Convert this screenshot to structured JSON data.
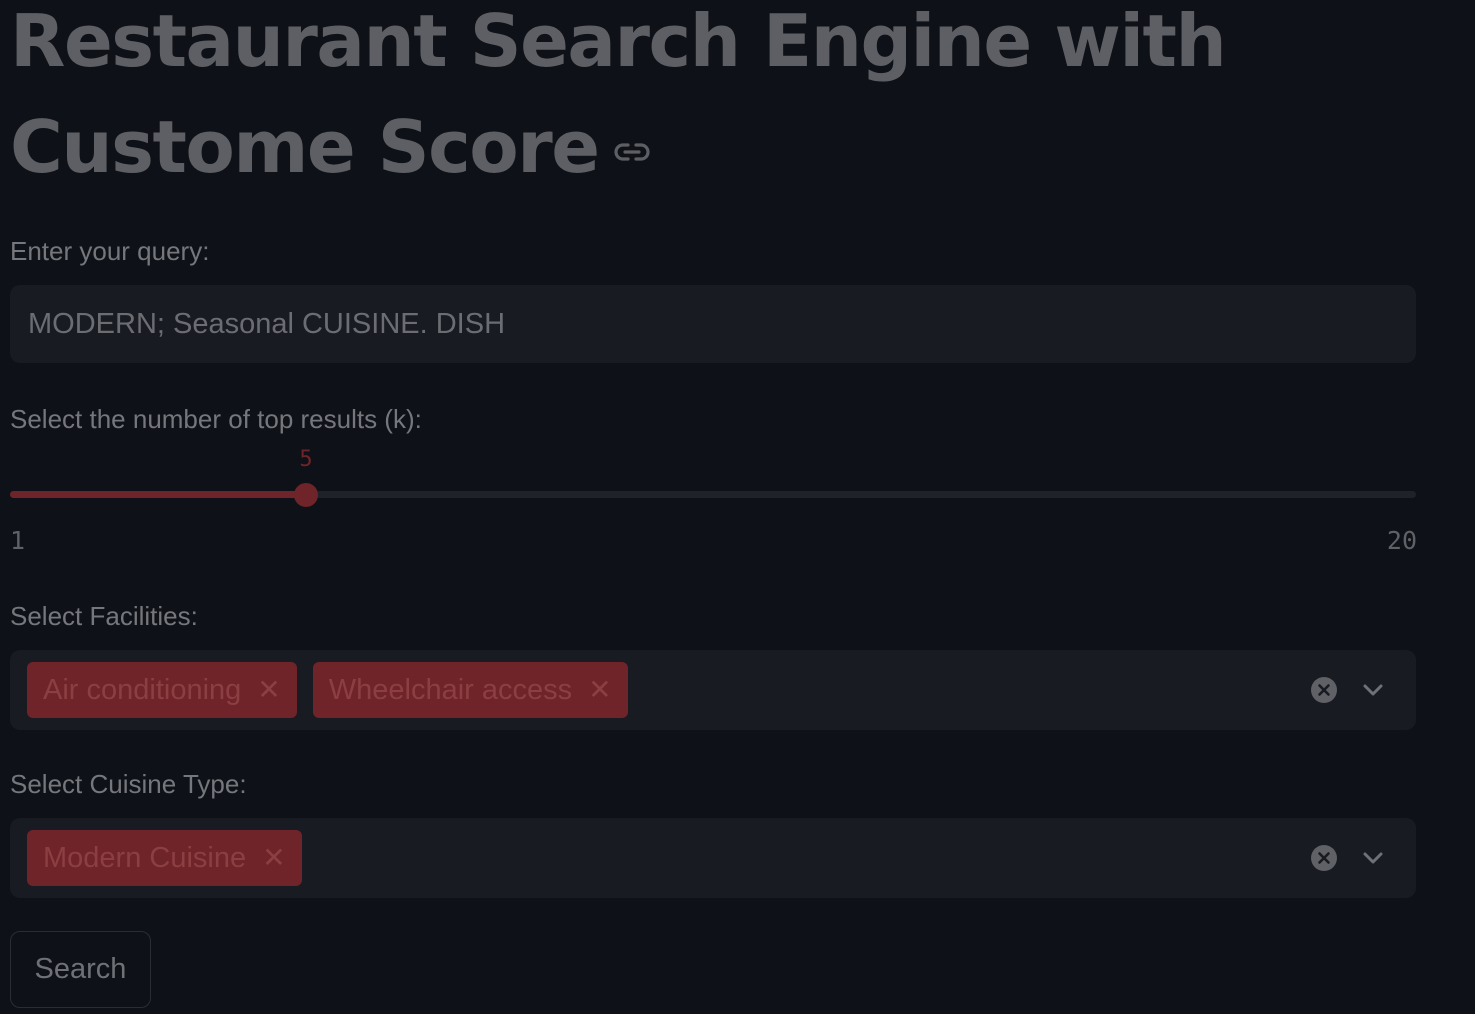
{
  "page": {
    "title": "Restaurant Search Engine with Custome Score"
  },
  "query": {
    "label": "Enter your query:",
    "value": "MODERN; Seasonal CUISINE. DISH"
  },
  "top_k": {
    "label": "Select the number of top results (k):",
    "value": 5,
    "min": 1,
    "max": 20,
    "value_text": "5",
    "min_text": "1",
    "max_text": "20"
  },
  "facilities": {
    "label": "Select Facilities:",
    "selected": [
      "Air conditioning",
      "Wheelchair access"
    ]
  },
  "cuisine": {
    "label": "Select Cuisine Type:",
    "selected": [
      "Modern Cuisine"
    ]
  },
  "search_button": {
    "label": "Search"
  },
  "colors": {
    "background": "#0e1117",
    "accent": "#6e2428",
    "input_bg": "#181b22"
  },
  "icons": {
    "title_anchor": "link-icon",
    "chip_remove": "close-icon",
    "clear_all": "clear-circle-icon",
    "dropdown": "chevron-down-icon"
  }
}
